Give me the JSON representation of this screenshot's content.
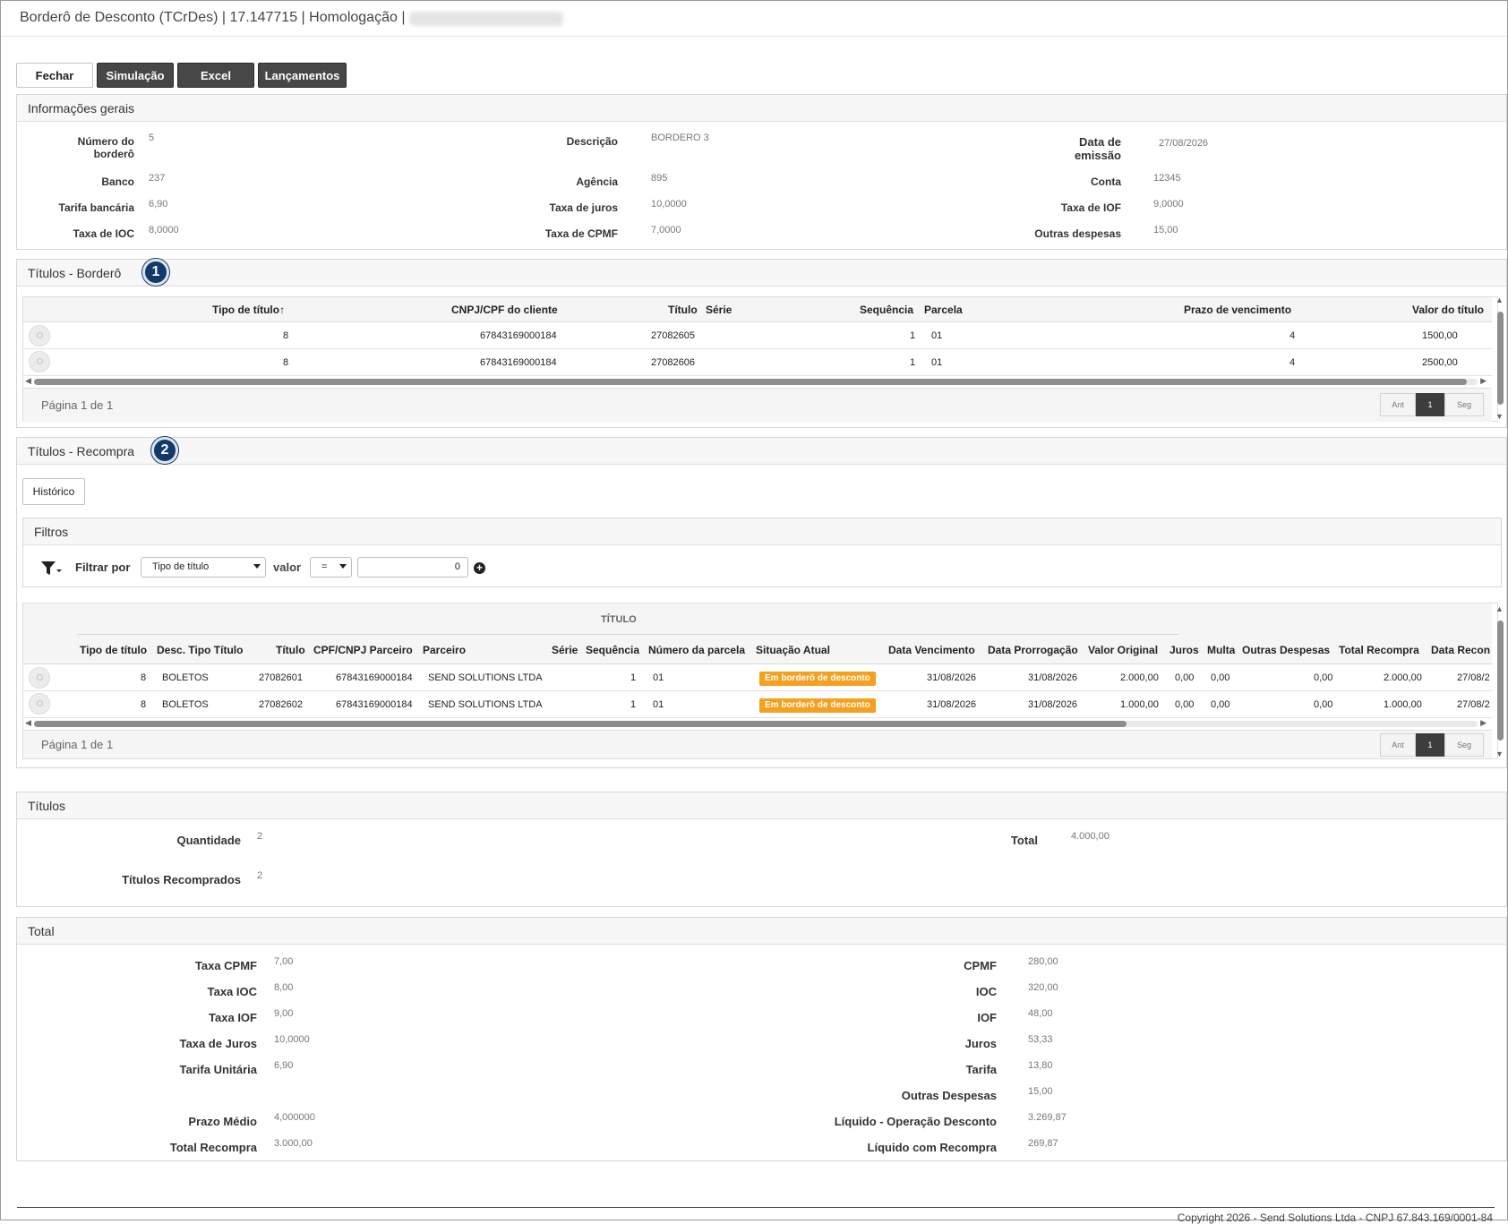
{
  "window": {
    "title": "Borderô de Desconto (TCrDes) | 17.147715 | Homologação |"
  },
  "toolbar": {
    "fechar": "Fechar",
    "simulacao": "Simulação",
    "excel": "Excel",
    "lancamentos": "Lançamentos"
  },
  "info": {
    "header": "Informações gerais",
    "numero_label": "Número do borderô",
    "numero": "5",
    "descricao_label": "Descrição",
    "descricao": "BORDERO 3",
    "data_emissao_label": "Data de emissão",
    "data_emissao": "27/08/2026",
    "banco_label": "Banco",
    "banco": "237",
    "agencia_label": "Agência",
    "agencia": "895",
    "conta_label": "Conta",
    "conta": "12345",
    "tarifa_label": "Tarifa bancária",
    "tarifa": "6,90",
    "juros_label": "Taxa de juros",
    "juros": "10,0000",
    "iof_label": "Taxa de IOF",
    "iof": "9,0000",
    "ioc_label": "Taxa de IOC",
    "ioc": "8,0000",
    "cpmf_label": "Taxa de CPMF",
    "cpmf": "7,0000",
    "outras_label": "Outras despesas",
    "outras": "15,00"
  },
  "bordero": {
    "header": "Títulos - Borderô",
    "badge": "1",
    "columns": [
      "Tipo de título",
      "CNPJ/CPF do cliente",
      "Título",
      "Série",
      "Sequência",
      "Parcela",
      "Prazo de vencimento",
      "Valor do título"
    ],
    "sort_arrow": "↑",
    "rows": [
      {
        "tipo": "8",
        "cnpj": "67843169000184",
        "titulo": "27082605",
        "serie": "",
        "seq": "1",
        "parcela": "01",
        "prazo": "4",
        "valor": "1500,00"
      },
      {
        "tipo": "8",
        "cnpj": "67843169000184",
        "titulo": "27082606",
        "serie": "",
        "seq": "1",
        "parcela": "01",
        "prazo": "4",
        "valor": "2500,00"
      }
    ],
    "pager_text": "Página 1 de 1",
    "pager": {
      "prev": "Ant",
      "current": "1",
      "next": "Seg"
    }
  },
  "recompra": {
    "header": "Títulos - Recompra",
    "badge": "2",
    "historico": "Histórico",
    "filtros_header": "Filtros",
    "filtrar_por": "Filtrar por",
    "filter_field": "Tipo de título",
    "valor_label": "valor",
    "operator": "=",
    "filter_value": "0",
    "group_header": "TÍTULO",
    "columns": [
      "Tipo de título",
      "Desc. Tipo Título",
      "Título",
      "CPF/CNPJ Parceiro",
      "Parceiro",
      "Série",
      "Sequência",
      "Número da parcela",
      "Situação Atual",
      "Data Vencimento",
      "Data Prorrogação",
      "Valor Original",
      "Juros",
      "Multa",
      "Outras Despesas",
      "Total Recompra",
      "Data Recon"
    ],
    "rows": [
      {
        "tipo": "8",
        "desc": "BOLETOS",
        "titulo": "27082601",
        "cpf": "67843169000184",
        "parceiro": "SEND SOLUTIONS LTDA",
        "serie": "",
        "seq": "1",
        "parcela": "01",
        "situacao": "Em borderô de desconto",
        "venc": "31/08/2026",
        "prorr": "31/08/2026",
        "valor": "2.000,00",
        "juros": "0,00",
        "multa": "0,00",
        "outras": "0,00",
        "total": "2.000,00",
        "recon": "27/08/2"
      },
      {
        "tipo": "8",
        "desc": "BOLETOS",
        "titulo": "27082602",
        "cpf": "67843169000184",
        "parceiro": "SEND SOLUTIONS LTDA",
        "serie": "",
        "seq": "1",
        "parcela": "01",
        "situacao": "Em borderô de desconto",
        "venc": "31/08/2026",
        "prorr": "31/08/2026",
        "valor": "1.000,00",
        "juros": "0,00",
        "multa": "0,00",
        "outras": "0,00",
        "total": "1.000,00",
        "recon": "27/08/2"
      }
    ],
    "pager_text": "Página 1 de 1",
    "pager": {
      "prev": "Ant",
      "current": "1",
      "next": "Seg"
    }
  },
  "titulos": {
    "header": "Títulos",
    "quantidade_label": "Quantidade",
    "quantidade": "2",
    "total_label": "Total",
    "total": "4.000,00",
    "recomprados_label": "Títulos Recomprados",
    "recomprados": "2"
  },
  "total": {
    "header": "Total",
    "left": [
      {
        "label": "Taxa CPMF",
        "value": "7,00"
      },
      {
        "label": "Taxa IOC",
        "value": "8,00"
      },
      {
        "label": "Taxa IOF",
        "value": "9,00"
      },
      {
        "label": "Taxa de Juros",
        "value": "10,0000"
      },
      {
        "label": "Tarifa Unitária",
        "value": "6,90"
      },
      {
        "label": "Prazo Médio",
        "value": "4,000000"
      },
      {
        "label": "Total Recompra",
        "value": "3.000,00"
      }
    ],
    "right": [
      {
        "label": "CPMF",
        "value": "280,00"
      },
      {
        "label": "IOC",
        "value": "320,00"
      },
      {
        "label": "IOF",
        "value": "48,00"
      },
      {
        "label": "Juros",
        "value": "53,33"
      },
      {
        "label": "Tarifa",
        "value": "13,80"
      },
      {
        "label": "Outras Despesas",
        "value": "15,00"
      },
      {
        "label": "Líquido - Operação Desconto",
        "value": "3.269,87"
      },
      {
        "label": "Líquido com Recompra",
        "value": "269,87"
      }
    ]
  },
  "footer": {
    "copyright": "Copyright 2026 - Send Solutions Ltda - CNPJ 67.843.169/0001-84"
  },
  "colors": {
    "accent_dark": "#474747",
    "badge": "#123a6a",
    "status": "#f5a01e"
  }
}
